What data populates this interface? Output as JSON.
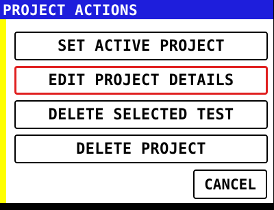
{
  "dialog": {
    "title": "PROJECT ACTIONS",
    "selected_index": 1,
    "items": [
      {
        "label": "SET ACTIVE PROJECT"
      },
      {
        "label": "EDIT PROJECT DETAILS"
      },
      {
        "label": "DELETE SELECTED TEST"
      },
      {
        "label": "DELETE PROJECT"
      }
    ],
    "cancel_label": "CANCEL"
  },
  "colors": {
    "title_bar": "#1e1edc",
    "title_text": "#ffffff",
    "frame": "#ffff00",
    "panel": "#ffffff",
    "selection_border": "#e02020",
    "button_border": "#000000"
  }
}
